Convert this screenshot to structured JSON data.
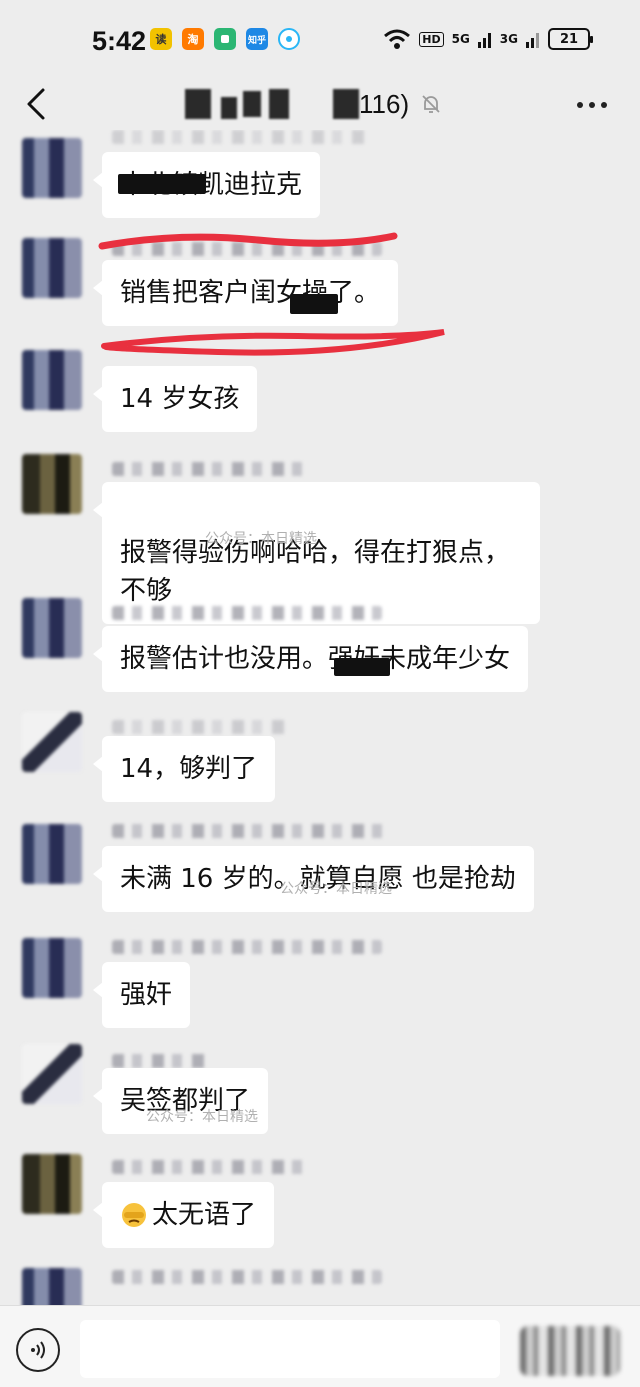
{
  "status_bar": {
    "time": "5:42",
    "app_icons": [
      {
        "name": "reader-app-icon",
        "label": "读",
        "color": "#f2c200",
        "text_color": "#333"
      },
      {
        "name": "taobao-app-icon",
        "label": "淘",
        "color": "#ff7a00",
        "text_color": "#fff"
      },
      {
        "name": "wechat-read-app-icon",
        "label": "",
        "color": "#2bb673",
        "text_color": "#fff"
      },
      {
        "name": "zhihu-app-icon",
        "label": "知乎",
        "color": "#1e88e5",
        "text_color": "#fff"
      },
      {
        "name": "circle-app-icon",
        "label": "",
        "color": "#29b6f6",
        "text_color": "#fff"
      }
    ],
    "network_labels": [
      "HD",
      "5G",
      "3G"
    ],
    "battery": "21"
  },
  "nav": {
    "title_count": "116)"
  },
  "messages": [
    {
      "text": "中北镇凯迪拉克"
    },
    {
      "text": "销售把客户闺女操了。"
    },
    {
      "text": "14 岁女孩"
    },
    {
      "text": "报警得验伤啊哈哈，得在打狠点，\n不够",
      "watermark": "公众号：本日精选"
    },
    {
      "text": "报警估计也没用。强奸未成年少女"
    },
    {
      "text": "14，够判了"
    },
    {
      "text": "未满 16 岁的。就算自愿 也是抢劫",
      "watermark": "公众号：本日精选"
    },
    {
      "text": "强奸"
    },
    {
      "text": "吴签都判了",
      "watermark": "公众号：本日精选"
    },
    {
      "text": "太无语了"
    }
  ],
  "colors": {
    "background": "#ededed",
    "bubble": "#ffffff",
    "red_scribble": "#e8303f"
  }
}
